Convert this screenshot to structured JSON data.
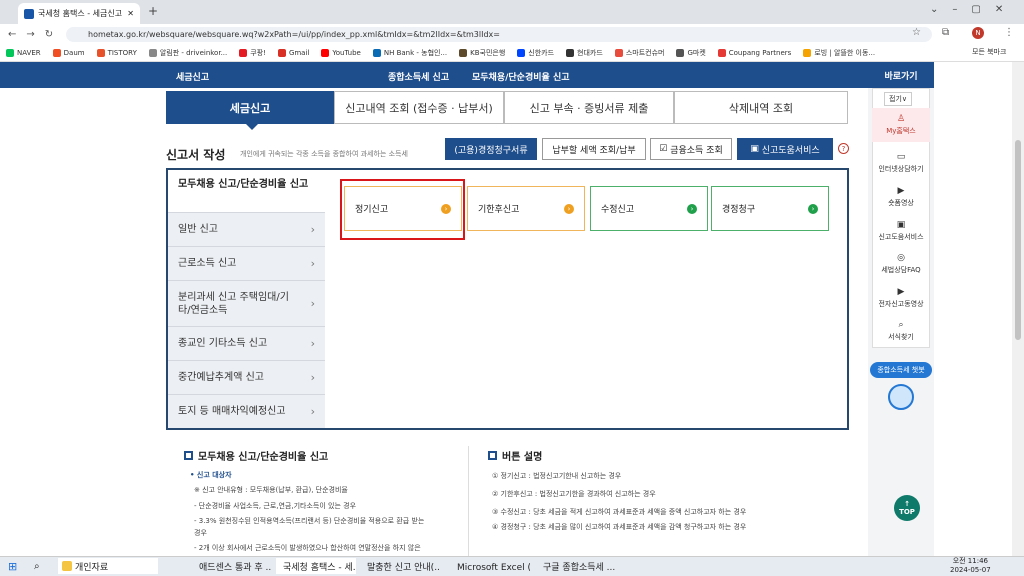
{
  "browser": {
    "tab_title": "국세청 홈택스 - 세금신고 > 종",
    "url": "hometax.go.kr/websquare/websquare.wq?w2xPath=/ui/pp/index_pp.xml&tmIdx=&tm2lIdx=&tm3lIdx=",
    "bookmarks": [
      "NAVER",
      "Daum",
      "TISTORY",
      "알림판 - driveinkor...",
      "쿠팡!",
      "Gmail",
      "YouTube",
      "NH Bank - 농협인...",
      "KB국민은행",
      "신한카드",
      "현대카드",
      "스마트컨슈머",
      "G마켓",
      "Coupang Partners",
      "로빙 | 알뜰한 이동..."
    ],
    "all_bookmarks": "모든 북마크"
  },
  "topnav": {
    "left": "세금신고",
    "mid": "종합소득세 신고",
    "right": "모두채용/단순경비율 신고"
  },
  "tabs": [
    "세금신고",
    "신고내역 조회 (접수증 · 납부서)",
    "신고 부속 · 증빙서류 제출",
    "삭제내역 조회"
  ],
  "form": {
    "title": "신고서 작성",
    "desc": "개인에게 귀속되는 각종 소득을 종합하여 과세하는 소득세",
    "buttons": [
      "(고용)경정청구서류",
      "납부할 세액 조회/납부",
      "금융소득 조회",
      "신고도움서비스"
    ],
    "help": "?"
  },
  "side_menu": {
    "head": "모두채용 신고/단순경비율 신고",
    "items": [
      {
        "label": "일반 신고"
      },
      {
        "label": "근로소득 신고"
      },
      {
        "label": "분리과세 신고 주택임대/기타/연금소득"
      },
      {
        "label": "종교인 기타소득 신고"
      },
      {
        "label": "중간예납추계액 신고"
      },
      {
        "label": "토지 등 매매차익예정신고"
      }
    ],
    "arrow": "›"
  },
  "cards": [
    {
      "label": "정기신고",
      "color": "orange"
    },
    {
      "label": "기한후신고",
      "color": "orange"
    },
    {
      "label": "수정신고",
      "color": "green"
    },
    {
      "label": "경정청구",
      "color": "green"
    }
  ],
  "bottom_left": {
    "title": "모두채용 신고/단순경비율 신고",
    "lines": [
      "• 신고 대상자",
      "※ 신고 안내유형 : 모두채용(납부, 환급), 단순경비율",
      "- 단순경비율 사업소득, 근로,연금,기타소득이 있는 경우",
      "- 3.3% 원천징수된 인적용역소득(프리랜서 등) 단순경비율 적용으로 환급 받는",
      "  경우",
      "- 2개 이상 회사에서 근로소득이 발생하였으나 합산하여 연말정산을 하지 않은"
    ]
  },
  "bottom_right": {
    "title": "버튼 설명",
    "lines": [
      "① 정기신고 : 법정신고기한내 신고하는 경우",
      "② 기한후신고 : 법정신고기한을 경과하여 신고하는 경우",
      "③ 수정신고 : 당초 세금을 적게 신고하여 과세표준과 세액을 증액 신고하고자 하는 경우",
      "④ 경정청구 : 당초 세금을 많이 신고하여 과세표준과 세액을 감액 청구하고자 하는 경우"
    ]
  },
  "right_sidebar": {
    "head": "바로가기",
    "fold": "접기∨",
    "items": [
      "My홈택스",
      "인터넷상담하기",
      "숏폼영상",
      "신고도움서비스",
      "세법상담FAQ",
      "전자신고동영상",
      "서식찾기"
    ],
    "chatbot": "종합소득세 챗봇",
    "top": "TOP"
  },
  "taskbar": {
    "items": [
      "개인자료",
      "애드센스 통과 후 ...",
      "국세청 홈택스 - 세...",
      "말충한 신고 안내(...",
      "Microsoft Excel (제...",
      "구글 종합소득세 ..."
    ],
    "time": "오전 11:46",
    "date": "2024-05-07"
  }
}
